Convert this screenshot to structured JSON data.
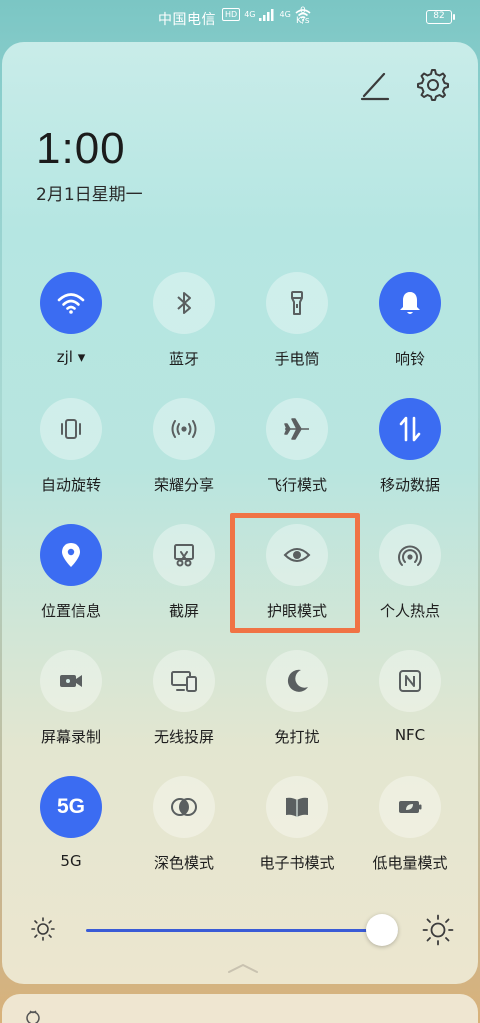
{
  "status_bar": {
    "carrier": "中国电信",
    "hd": "HD",
    "network_4g_a": "4G",
    "network_4g_b": "4G",
    "speed_value": "0",
    "speed_unit": "K/s",
    "battery": "82"
  },
  "header": {
    "time": "1:00",
    "date": "2月1日星期一"
  },
  "tiles": [
    {
      "label": "zjl ▾",
      "icon": "wifi-icon",
      "on": true
    },
    {
      "label": "蓝牙",
      "icon": "bluetooth-icon",
      "on": false
    },
    {
      "label": "手电筒",
      "icon": "flashlight-icon",
      "on": false
    },
    {
      "label": "响铃",
      "icon": "bell-icon",
      "on": true
    },
    {
      "label": "自动旋转",
      "icon": "auto-rotate-icon",
      "on": false
    },
    {
      "label": "荣耀分享",
      "icon": "share-icon",
      "on": false
    },
    {
      "label": "飞行模式",
      "icon": "airplane-icon",
      "on": false
    },
    {
      "label": "移动数据",
      "icon": "mobile-data-icon",
      "on": true
    },
    {
      "label": "位置信息",
      "icon": "location-icon",
      "on": true
    },
    {
      "label": "截屏",
      "icon": "screenshot-icon",
      "on": false
    },
    {
      "label": "护眼模式",
      "icon": "eye-icon",
      "on": false
    },
    {
      "label": "个人热点",
      "icon": "hotspot-icon",
      "on": false
    },
    {
      "label": "屏幕录制",
      "icon": "screen-record-icon",
      "on": false
    },
    {
      "label": "无线投屏",
      "icon": "wireless-projection-icon",
      "on": false
    },
    {
      "label": "免打扰",
      "icon": "moon-icon",
      "on": false
    },
    {
      "label": "NFC",
      "icon": "nfc-icon",
      "on": false
    },
    {
      "label": "5G",
      "icon": "5g-icon",
      "on": true,
      "icon_text": "5G"
    },
    {
      "label": "深色模式",
      "icon": "dark-mode-icon",
      "on": false
    },
    {
      "label": "电子书模式",
      "icon": "ebook-icon",
      "on": false
    },
    {
      "label": "低电量模式",
      "icon": "battery-saver-icon",
      "on": false
    }
  ],
  "brightness": {
    "level": 0.95
  },
  "colors": {
    "accent": "#3b6cf2",
    "highlight": "#f07345"
  }
}
